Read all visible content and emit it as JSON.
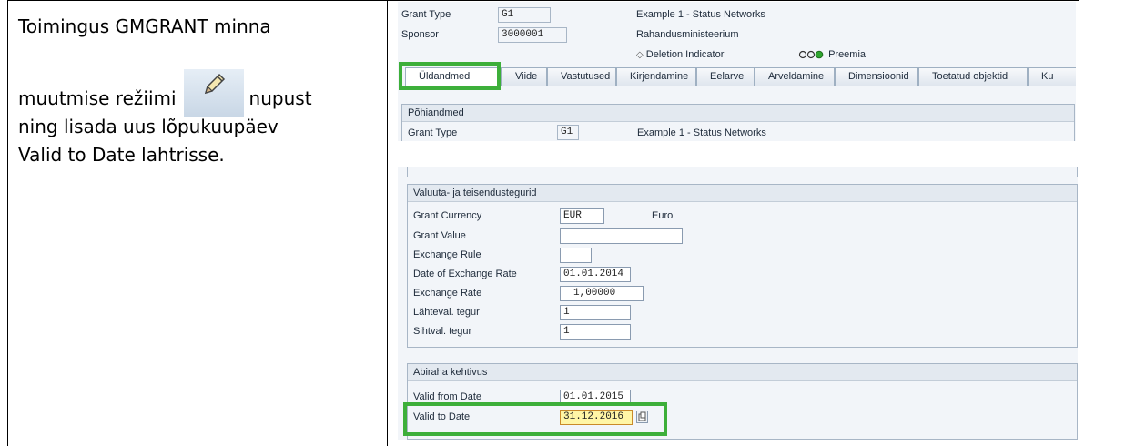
{
  "instruction": {
    "line1": "Toimingus GMGRANT minna",
    "line2_before": "muutmise režiimi",
    "line2_after": "nupust",
    "line3": "ning lisada uus lõpukuupäev",
    "line4": "Valid to Date lahtrisse.",
    "button_icon": "pencil-icon"
  },
  "top_screen": {
    "grant_type_label": "Grant Type",
    "grant_type_value": "G1",
    "grant_type_desc": "Example 1 - Status Networks",
    "sponsor_label": "Sponsor",
    "sponsor_value": "3000001",
    "sponsor_desc": "Rahandusministeerium",
    "deletion_indicator": "Deletion Indicator",
    "status_text": "Preemia",
    "tabs": [
      "Üldandmed",
      "Viide",
      "Vastutused",
      "Kirjendamine",
      "Eelarve",
      "Arveldamine",
      "Dimensioonid",
      "Toetatud objektid",
      "Ku"
    ],
    "group_title": "Põhiandmed",
    "pg_grant_type_label": "Grant Type",
    "pg_grant_type_value": "G1",
    "pg_grant_type_desc": "Example 1 - Status Networks"
  },
  "currency_group": {
    "title": "Valuuta- ja teisendustegurid",
    "grant_currency_label": "Grant Currency",
    "grant_currency_value": "EUR",
    "grant_currency_desc": "Euro",
    "grant_value_label": "Grant Value",
    "grant_value_value": "",
    "exchange_rule_label": "Exchange Rule",
    "exchange_rule_value": "",
    "date_exchange_label": "Date of Exchange Rate",
    "date_exchange_value": "01.01.2014",
    "exchange_rate_label": "Exchange Rate",
    "exchange_rate_value": "1,00000",
    "source_factor_label": "Lähteval. tegur",
    "source_factor_value": "1",
    "target_factor_label": "Sihtval. tegur",
    "target_factor_value": "1"
  },
  "validity_group": {
    "title": "Abiraha kehtivus",
    "valid_from_label": "Valid from Date",
    "valid_from_value": "01.01.2015",
    "valid_to_label": "Valid to Date",
    "valid_to_value": "31.12.2016"
  },
  "colors": {
    "highlight": "#3daf3a",
    "sap_bg": "#f2f5f9",
    "edit_field": "#fff6a6"
  }
}
